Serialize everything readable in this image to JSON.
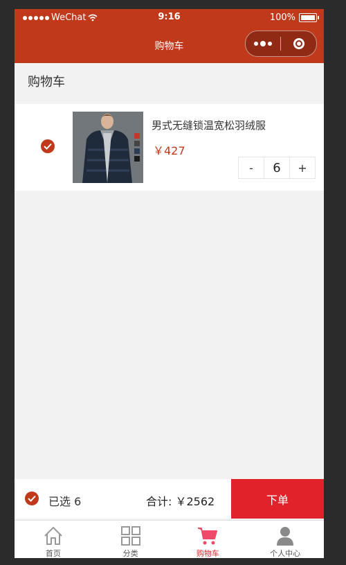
{
  "status_bar": {
    "carrier": "WeChat",
    "time": "9:16",
    "battery": "100%"
  },
  "nav": {
    "title": "购物车"
  },
  "page": {
    "heading": "购物车"
  },
  "cart": {
    "items": [
      {
        "name": "男式无缝锁温宽松羽绒服",
        "price": "￥427",
        "quantity": "6",
        "minus_label": "-",
        "plus_label": "+",
        "checked": true
      }
    ]
  },
  "footer": {
    "selected_text": "已选 6",
    "total_text": "合计: ￥2562",
    "order_label": "下单"
  },
  "tabbar": {
    "tabs": [
      {
        "label": "首页",
        "icon": "home-icon"
      },
      {
        "label": "分类",
        "icon": "category-icon"
      },
      {
        "label": "购物车",
        "icon": "cart-icon",
        "active": true
      },
      {
        "label": "个人中心",
        "icon": "person-icon"
      }
    ]
  },
  "colors": {
    "primary": "#c0391b",
    "order_button": "#e2222b",
    "active_tab": "#e2222b"
  }
}
